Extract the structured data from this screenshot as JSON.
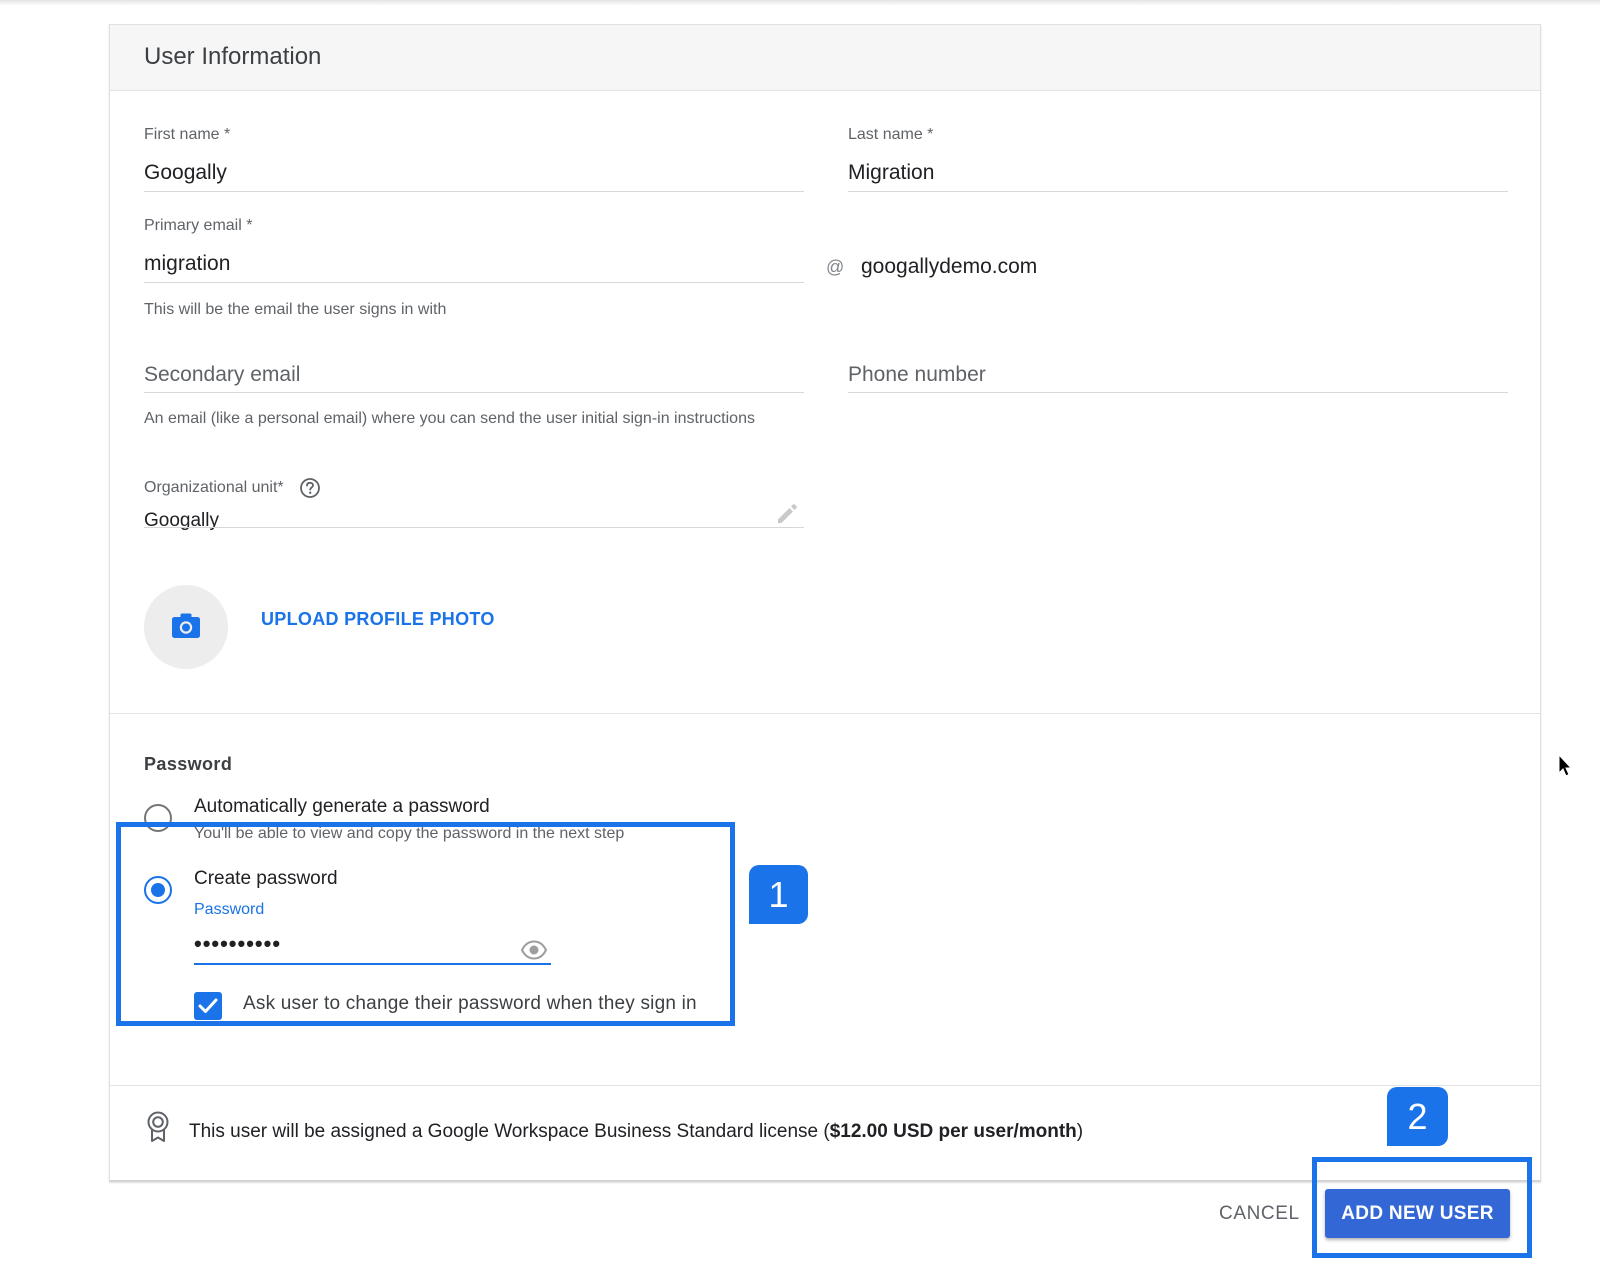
{
  "section": {
    "title": "User Information"
  },
  "fields": {
    "first_name": {
      "label": "First name *",
      "value": "Googally"
    },
    "last_name": {
      "label": "Last name *",
      "value": "Migration"
    },
    "primary_email": {
      "label": "Primary email *",
      "value": "migration",
      "at": "@",
      "domain": "googallydemo.com",
      "hint": "This will be the email the user signs in with"
    },
    "secondary_email": {
      "placeholder": "Secondary email",
      "hint": "An email (like a personal email) where you can send the user initial sign-in instructions"
    },
    "phone": {
      "placeholder": "Phone number"
    },
    "org_unit": {
      "label": "Organizational unit*",
      "value": "Googally"
    }
  },
  "photo": {
    "upload_label": "UPLOAD PROFILE PHOTO"
  },
  "password": {
    "title": "Password",
    "auto": {
      "label": "Automatically generate a password",
      "hint": "You'll be able to view and copy the password in the next step",
      "selected": false
    },
    "create": {
      "label": "Create password",
      "selected": true,
      "field_label": "Password",
      "value": "••••••••••"
    },
    "change_on_signin": {
      "label": "Ask user to change their password when they sign in",
      "checked": true
    }
  },
  "license": {
    "text_prefix": "This user will be assigned a Google Workspace Business Standard license (",
    "price": "$12.00 USD per user/month",
    "text_suffix": ")"
  },
  "actions": {
    "cancel": "CANCEL",
    "add": "ADD NEW USER"
  },
  "annotations": {
    "badge1": "1",
    "badge2": "2"
  },
  "colors": {
    "accent": "#1a73e8",
    "primary_button": "#3367d6",
    "text": "#202124",
    "muted": "#5f6368"
  }
}
